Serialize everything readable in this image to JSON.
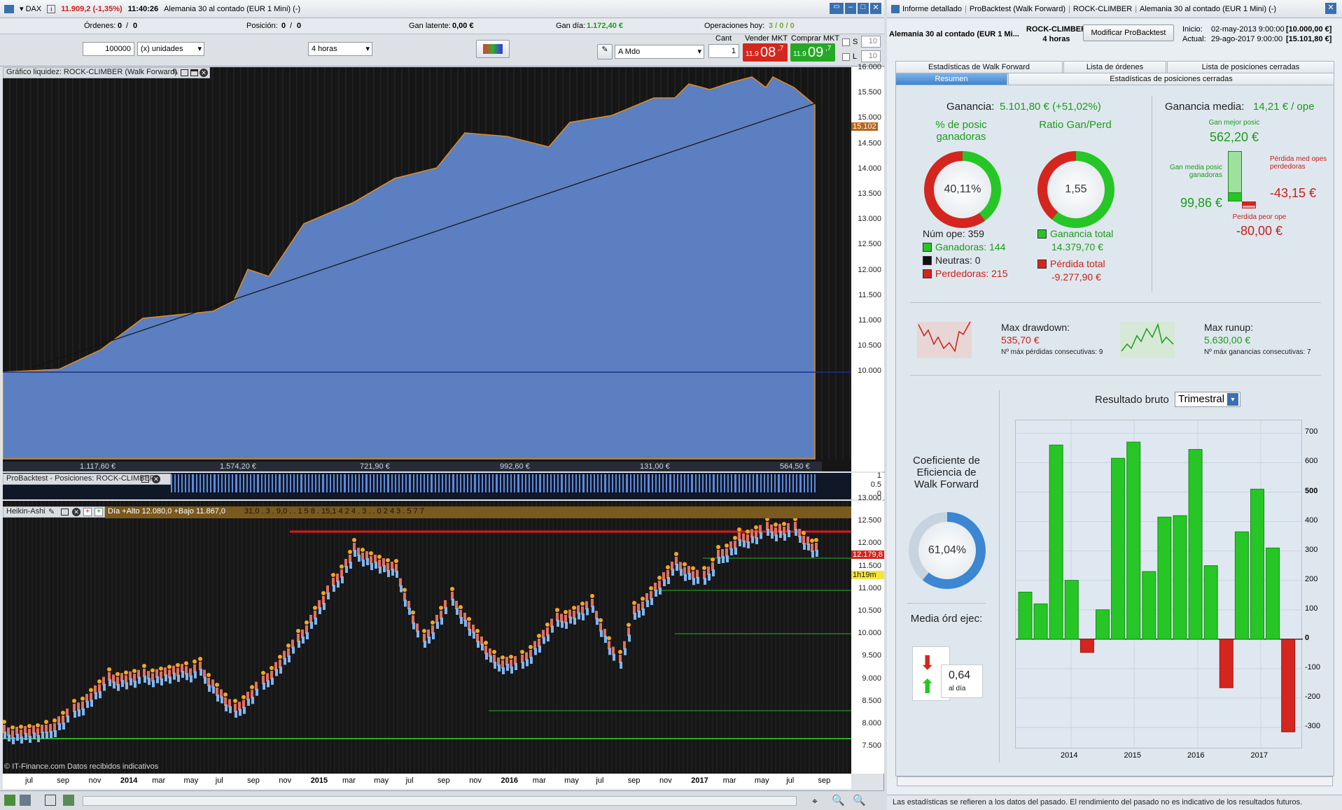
{
  "left_title": {
    "symbol": "DAX",
    "price": "11.909,2 (-1,35%)",
    "time": "11:40:26",
    "instrument": "Alemania 30 al contado (EUR 1 Mini) (-)"
  },
  "left_win_buttons": [
    "▭",
    "–",
    "□",
    "✕"
  ],
  "stats_row": {
    "ordenes_label": "Órdenes:",
    "ordenes_v1": "0",
    "ordenes_sep": "/",
    "ordenes_v2": "0",
    "posicion_label": "Posición:",
    "posicion_v1": "0",
    "posicion_sep": "/",
    "posicion_v2": "0",
    "gan_latente_label": "Gan latente:",
    "gan_latente": "0,00 €",
    "gan_dia_label": "Gan día:",
    "gan_dia": "1.172,40 €",
    "operaciones_label": "Operaciones hoy:",
    "operaciones": "3 / 0 / 0"
  },
  "order": {
    "qty": "100000",
    "unit": "(x) unidades",
    "timeframe": "4 horas",
    "order_type": "A Mdo",
    "cant_label": "Cant",
    "cant": "1",
    "sell_label": "Vender MKT",
    "sell_small": "11.9",
    "sell_big": "08",
    "sell_sup": ",7",
    "buy_label": "Comprar MKT",
    "buy_small": "11.9",
    "buy_big": "09",
    "buy_sup": ",7",
    "s_label": "S",
    "s_val": "10",
    "l_label": "L",
    "l_val": "10"
  },
  "equity_chart": {
    "title": "Gráfico liquidez: ROCK-CLIMBER (Walk Forward)",
    "current": "15.102",
    "axis": [
      "16.000",
      "15.500",
      "15.000",
      "14.500",
      "14.000",
      "13.500",
      "13.000",
      "12.500",
      "12.000",
      "11.500",
      "11.000",
      "10.500",
      "10.000"
    ],
    "bottom_vals": [
      "1.117,60 €",
      "1.574,20 €",
      "721,90 €",
      "992,60 €",
      "131,00 €",
      "564,50 €"
    ]
  },
  "positions_panel": {
    "title": "ProBacktest - Posiciones: ROCK-CLIMBER",
    "axis": [
      "1",
      "0.5",
      "0"
    ]
  },
  "price_chart": {
    "title": "Heikin-Ashi",
    "info": "Día +Alto 12.080,0 +Bajo 11.867,0",
    "counts": "31,0 . 3 . 9,0 . . 1 5 8 . 15,1 4 2 4 . 3 . . 0 2 4 3 . 5 7 7",
    "axis": [
      "13.000",
      "12.500",
      "12.000",
      "11.500",
      "11.000",
      "10.500",
      "10.000",
      "9.500",
      "9.000",
      "8.500",
      "8.000",
      "7.500"
    ],
    "last_price": "12.179,8",
    "timer": "1h19m",
    "footer": "© IT-Finance.com Datos recibidos indicativos",
    "xlabels": [
      {
        "t": "jul",
        "b": false
      },
      {
        "t": "sep",
        "b": false
      },
      {
        "t": "nov",
        "b": false
      },
      {
        "t": "2014",
        "b": true
      },
      {
        "t": "mar",
        "b": false
      },
      {
        "t": "may",
        "b": false
      },
      {
        "t": "jul",
        "b": false
      },
      {
        "t": "sep",
        "b": false
      },
      {
        "t": "nov",
        "b": false
      },
      {
        "t": "2015",
        "b": true
      },
      {
        "t": "mar",
        "b": false
      },
      {
        "t": "may",
        "b": false
      },
      {
        "t": "jul",
        "b": false
      },
      {
        "t": "sep",
        "b": false
      },
      {
        "t": "nov",
        "b": false
      },
      {
        "t": "2016",
        "b": true
      },
      {
        "t": "mar",
        "b": false
      },
      {
        "t": "may",
        "b": false
      },
      {
        "t": "jul",
        "b": false
      },
      {
        "t": "sep",
        "b": false
      },
      {
        "t": "nov",
        "b": false
      },
      {
        "t": "2017",
        "b": true
      },
      {
        "t": "mar",
        "b": false
      },
      {
        "t": "may",
        "b": false
      },
      {
        "t": "jul",
        "b": false
      },
      {
        "t": "sep",
        "b": false
      }
    ]
  },
  "right_title": {
    "tabs": [
      "Informe detallado",
      "ProBacktest (Walk Forward)",
      "ROCK-CLIMBER",
      "Alemania 30 al contado (EUR 1 Mini) (-)"
    ]
  },
  "report_header": {
    "instrument": "Alemania 30 al contado (EUR 1 Mi...",
    "system": "ROCK-CLIMBER",
    "timeframe": "4 horas",
    "modify_button": "Modificar ProBacktest",
    "inicio_label": "Inicio:",
    "inicio": "02-may-2013 9:00:00",
    "inicio_cap": "[10.000,00 €]",
    "actual_label": "Actual:",
    "actual": "29-ago-2017 9:00:00",
    "actual_cap": "[15.101,80 €]"
  },
  "tabs_row1": [
    "Estadísticas de Walk Forward",
    "Lista de órdenes",
    "Lista de posiciones cerradas"
  ],
  "tabs_row2": [
    "Resumen",
    "Estadísticas de posiciones cerradas"
  ],
  "summary": {
    "ganancia_label": "Ganancia:",
    "ganancia": "5.101,80 € (+51,02%)",
    "pct_title": "% de posic ganadoras",
    "pct": "40,11%",
    "ratio_title": "Ratio Gan/Perd",
    "ratio": "1,55",
    "num_ope": "Núm ope: 359",
    "ganadoras": "Ganadoras: 144",
    "neutras": "Neutras: 0",
    "perdedoras": "Perdedoras: 215",
    "ganancia_total_label": "Ganancia total",
    "ganancia_total": "14.379,70 €",
    "perdida_total_label": "Pérdida total",
    "perdida_total": "-9.277,90 €",
    "gan_media_label": "Ganancia media:",
    "gan_media": "14,21 € / ope",
    "gan_mejor_label": "Gan mejor posic",
    "gan_mejor": "562,20 €",
    "gan_media_posic_label": "Gan media posic ganadoras",
    "gan_media_posic": "99,86 €",
    "perdida_med_label": "Pérdida med opes perdedoras",
    "perdida_med": "-43,15 €",
    "perdida_peor_label": "Perdida peor ope",
    "perdida_peor": "-80,00 €",
    "max_dd_label": "Max drawdown:",
    "max_dd": "535,70 €",
    "max_dd_sub": "Nº máx pérdidas consecutivas: 9",
    "max_ru_label": "Max runup:",
    "max_ru": "5.630,00 €",
    "max_ru_sub": "Nº máx ganancias consecutivas: 7",
    "coef_title": "Coeficiente de Eficiencia de Walk Forward",
    "coef": "61,04%",
    "media_ord_title": "Media órd ejec:",
    "media_ord": "0,64",
    "media_ord_sub": "al día"
  },
  "colors": {
    "green": "#26c626",
    "red": "#d4261e",
    "blue": "#3c86d2",
    "equity": "#5b7fc0"
  },
  "chart_data": {
    "type": "bar",
    "title": "Resultado bruto",
    "period": "Trimestral",
    "ylim": [
      -350,
      720
    ],
    "yticks": [
      700,
      600,
      500,
      400,
      300,
      200,
      100,
      0,
      -100,
      -200,
      -300
    ],
    "xlabels": [
      "2014",
      "2015",
      "2016",
      "2017"
    ],
    "values": [
      160,
      120,
      660,
      200,
      -45,
      100,
      615,
      670,
      230,
      415,
      420,
      645,
      250,
      -165,
      365,
      510,
      310,
      -315
    ]
  },
  "disclaimer": "Las estadísticas se refieren a los datos del pasado. El rendimiento del pasado no es indicativo de los resultados futuros."
}
